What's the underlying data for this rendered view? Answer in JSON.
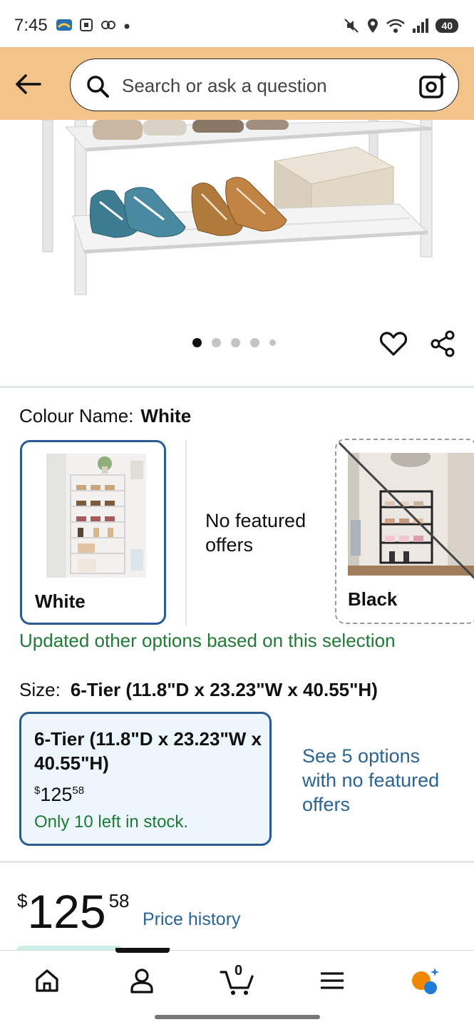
{
  "status_bar": {
    "time": "7:45",
    "battery": "40",
    "icons": [
      "notification-app-icon",
      "screenshot-icon",
      "link-icon",
      "dot-icon",
      "mute-icon",
      "location-icon",
      "wifi-icon",
      "signal-icon",
      "battery-icon"
    ]
  },
  "header": {
    "back_icon": "arrow-left-icon",
    "search_placeholder": "Search or ask a question",
    "camera_icon": "camera-search-icon",
    "background": "#f2c48a"
  },
  "gallery": {
    "image_count": 5,
    "active_index": 0,
    "actions": [
      "heart-icon",
      "share-icon"
    ]
  },
  "colour": {
    "label": "Colour Name:",
    "selected": "White",
    "options": [
      {
        "label": "White",
        "selected": true,
        "available": true
      },
      {
        "label": "No featured offers"
      },
      {
        "label": "Black",
        "selected": false,
        "available": false
      }
    ],
    "updated_message": "Updated other options based on this selection"
  },
  "size": {
    "label": "Size:",
    "selected": "6-Tier (11.8\"D x 23.23\"W x 40.55\"H)",
    "card": {
      "title": "6-Tier (11.8\"D x 23.23\"W x 40.55\"H)",
      "price_currency": "$",
      "price_whole": "125",
      "price_fraction": "58",
      "stock": "Only 10 left in stock."
    },
    "see_options": "See 5 options with no featured offers"
  },
  "price": {
    "currency": "$",
    "whole": "125",
    "fraction": "58",
    "history_link": "Price history"
  },
  "bottom_nav": {
    "items": [
      "home-icon",
      "account-icon",
      "cart-icon",
      "menu-icon",
      "rufus-assistant-icon"
    ],
    "cart_count": "0",
    "active_item": "account-icon"
  },
  "colors": {
    "selected_border": "#2a5c94",
    "link": "#2a6496",
    "in_stock_green": "#1f7a36"
  }
}
